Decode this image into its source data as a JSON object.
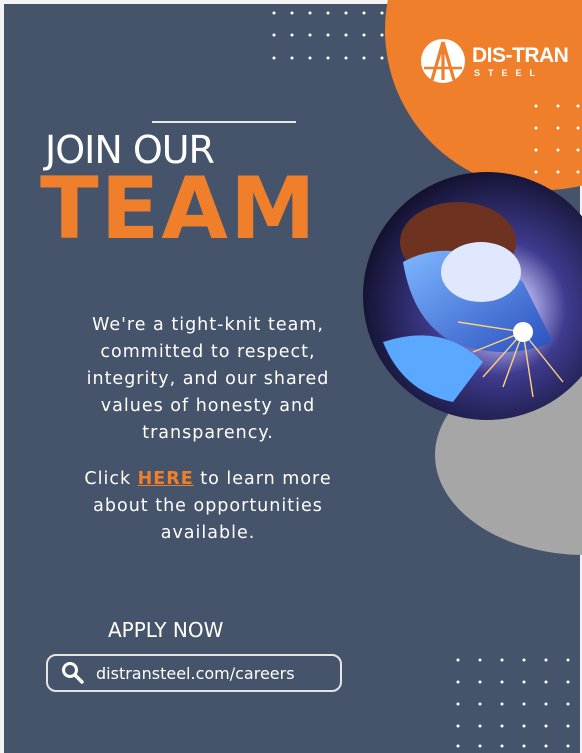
{
  "brand": {
    "name": "DIS-TRAN",
    "sub": "STEEL",
    "colors": {
      "orange": "#f07f2c",
      "slate": "#45546a",
      "grey": "#a6a6a6"
    }
  },
  "headline": {
    "line1": "JOIN OUR",
    "line2": "TEAM"
  },
  "body": {
    "paragraph": "We're a tight-knit team, committed to respect, integrity, and our shared values of honesty and transparency.",
    "cta_prefix": "Click ",
    "cta_link": "HERE",
    "cta_suffix": " to learn more about the opportunities available."
  },
  "apply": {
    "label": "APPLY NOW",
    "url": "distransteel.com/careers",
    "icon": "search-icon"
  },
  "photo": {
    "subject": "welder-image"
  }
}
